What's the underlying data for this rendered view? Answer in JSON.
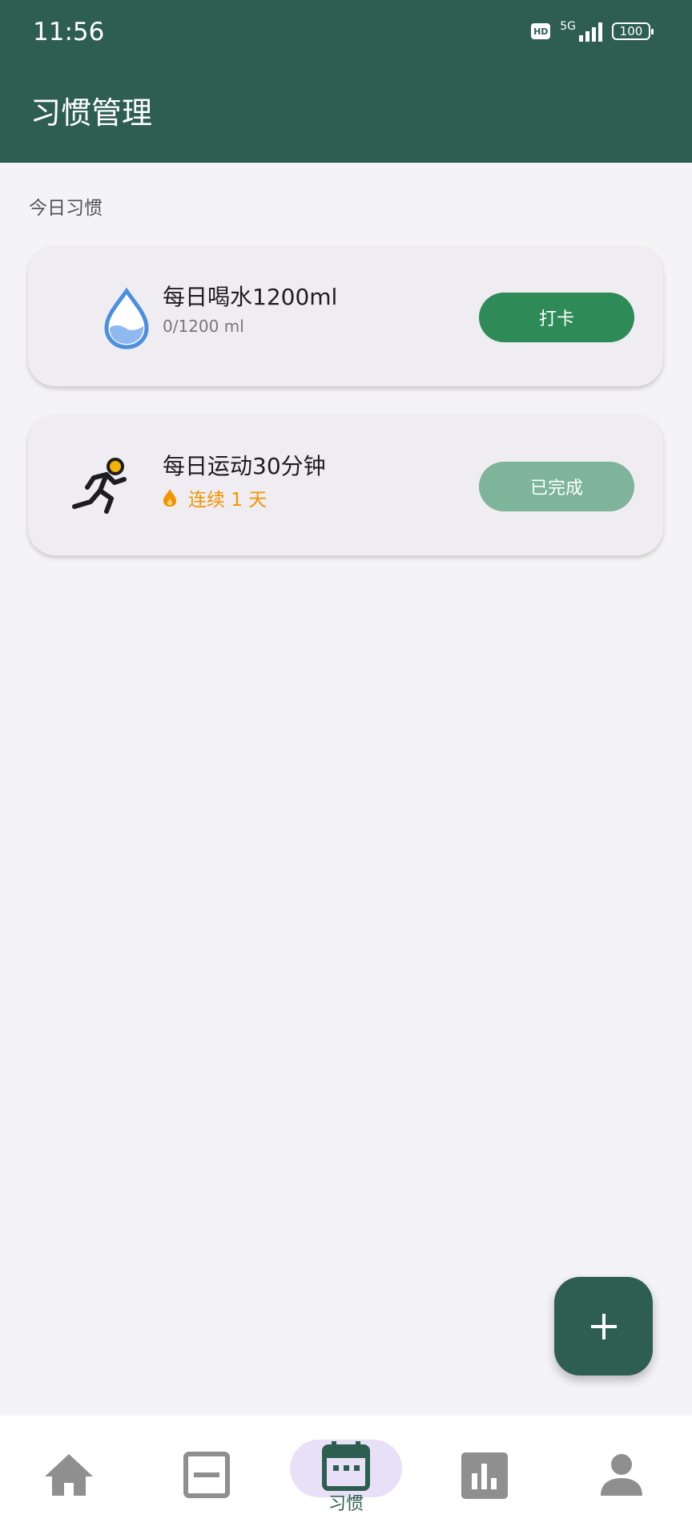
{
  "status_bar": {
    "time": "11:56",
    "hd_label": "HD",
    "network_label": "5G",
    "battery": "100"
  },
  "header": {
    "title": "习惯管理"
  },
  "section": {
    "title": "今日习惯"
  },
  "habits": [
    {
      "icon": "water-drop-icon",
      "title": "每日喝水1200ml",
      "subtitle": "0/1200 ml",
      "button": "打卡",
      "status": "pending"
    },
    {
      "icon": "running-person-icon",
      "title": "每日运动30分钟",
      "streak": "连续 1 天",
      "button": "已完成",
      "status": "completed"
    }
  ],
  "fab": {
    "icon": "plus-icon"
  },
  "bottom_nav": {
    "items": [
      {
        "name": "home",
        "icon": "home-icon"
      },
      {
        "name": "records",
        "icon": "note-icon"
      },
      {
        "name": "habits",
        "icon": "calendar-icon",
        "label": "习惯",
        "active": true
      },
      {
        "name": "stats",
        "icon": "bar-chart-icon"
      },
      {
        "name": "profile",
        "icon": "person-icon"
      }
    ]
  },
  "colors": {
    "primary": "#2e5e4f",
    "checkin_button": "#2e8b57",
    "done_button": "#7db49a",
    "streak": "#f29400",
    "active_nav_pill": "#e8e0f7"
  }
}
